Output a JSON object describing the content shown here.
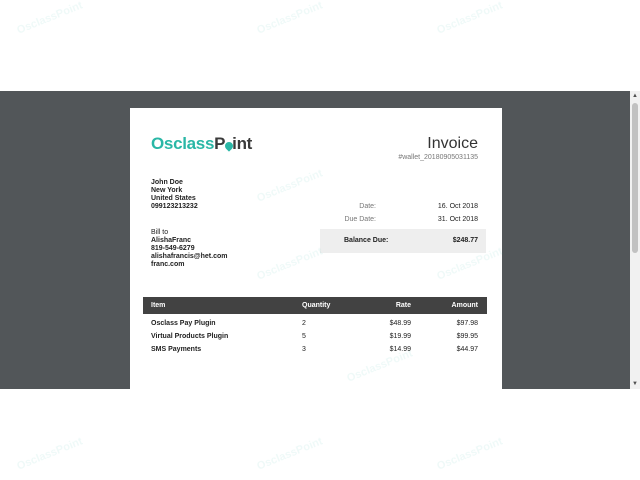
{
  "brand": {
    "part1": "Osclass",
    "part2_a": "P",
    "part2_b": "int"
  },
  "watermark": {
    "text": "OsclassPoint"
  },
  "invoice": {
    "title": "Invoice",
    "number": "#wallet_20180905031135",
    "from": {
      "name": "John Doe",
      "city": "New York",
      "country": "United States",
      "phone": "099123213232"
    },
    "bill_to": {
      "label": "Bill to",
      "name": "AlishaFranc",
      "phone": "819-549-6279",
      "email": "alishafrancis@het.com",
      "website": "franc.com"
    },
    "date_label": "Date:",
    "date": "16. Oct 2018",
    "due_label": "Due Date:",
    "due_date": "31. Oct 2018",
    "balance_label": "Balance Due:",
    "balance": "$248.77",
    "columns": {
      "item": "Item",
      "quantity": "Quantity",
      "rate": "Rate",
      "amount": "Amount"
    },
    "items": [
      {
        "name": "Osclass Pay Plugin",
        "qty": "2",
        "rate": "$48.99",
        "amount": "$97.98"
      },
      {
        "name": "Virtual Products Plugin",
        "qty": "5",
        "rate": "$19.99",
        "amount": "$99.95"
      },
      {
        "name": "SMS Payments",
        "qty": "3",
        "rate": "$14.99",
        "amount": "$44.97"
      }
    ]
  },
  "colors": {
    "brand": "#2ab7a6",
    "viewer_bg": "#525659",
    "table_header": "#424242",
    "balance_bg": "#eeeeee"
  },
  "scroll": {
    "up_icon": "triangle-up",
    "down_icon": "triangle-down"
  }
}
